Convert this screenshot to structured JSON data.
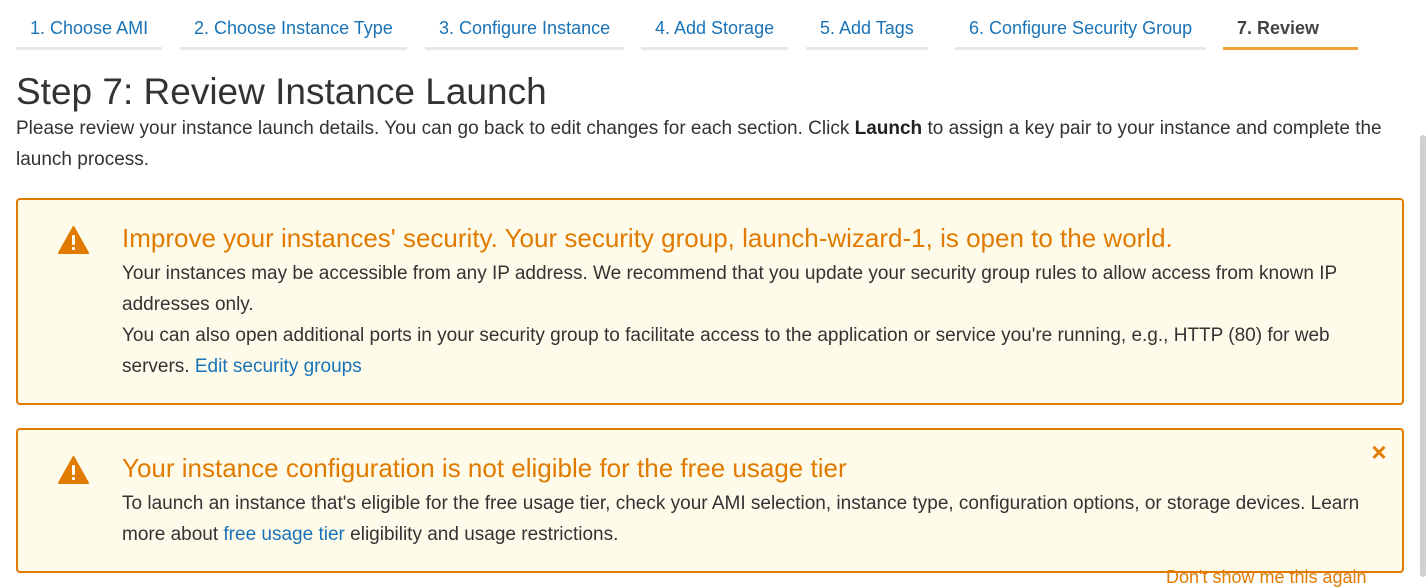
{
  "tabs": [
    {
      "label": "1. Choose AMI"
    },
    {
      "label": "2. Choose Instance Type"
    },
    {
      "label": "3. Configure Instance"
    },
    {
      "label": "4. Add Storage"
    },
    {
      "label": "5. Add Tags"
    },
    {
      "label": "6. Configure Security Group"
    },
    {
      "label": "7. Review",
      "active": true
    }
  ],
  "page": {
    "title": "Step 7: Review Instance Launch",
    "intro_before": "Please review your instance launch details. You can go back to edit changes for each section. Click ",
    "intro_bold": "Launch",
    "intro_after": " to assign a key pair to your instance and complete the launch process."
  },
  "alerts": [
    {
      "icon": "warning-icon",
      "title": "Improve your instances' security. Your security group, launch-wizard-1, is open to the world.",
      "paragraph1": "Your instances may be accessible from any IP address. We recommend that you update your security group rules to allow access from known IP addresses only.",
      "paragraph2_text": "You can also open additional ports in your security group to facilitate access to the application or service you're running, e.g., HTTP (80) for web servers. ",
      "link": "Edit security groups"
    },
    {
      "icon": "warning-icon",
      "title": "Your instance configuration is not eligible for the free usage tier",
      "body_before": "To launch an instance that's eligible for the free usage tier, check your AMI selection, instance type, configuration options, or storage devices. Learn more about ",
      "link": "free usage tier",
      "body_after": " eligibility and usage restrictions.",
      "close_icon": "close-icon",
      "dont_show": "Don't show me this again"
    }
  ],
  "colors": {
    "link": "#1a73b6",
    "warning": "#e07b00",
    "alert_bg": "#fffbea",
    "active_tab_underline": "#f0a535",
    "tab_underline": "#e8e8e8",
    "text": "#333333"
  }
}
